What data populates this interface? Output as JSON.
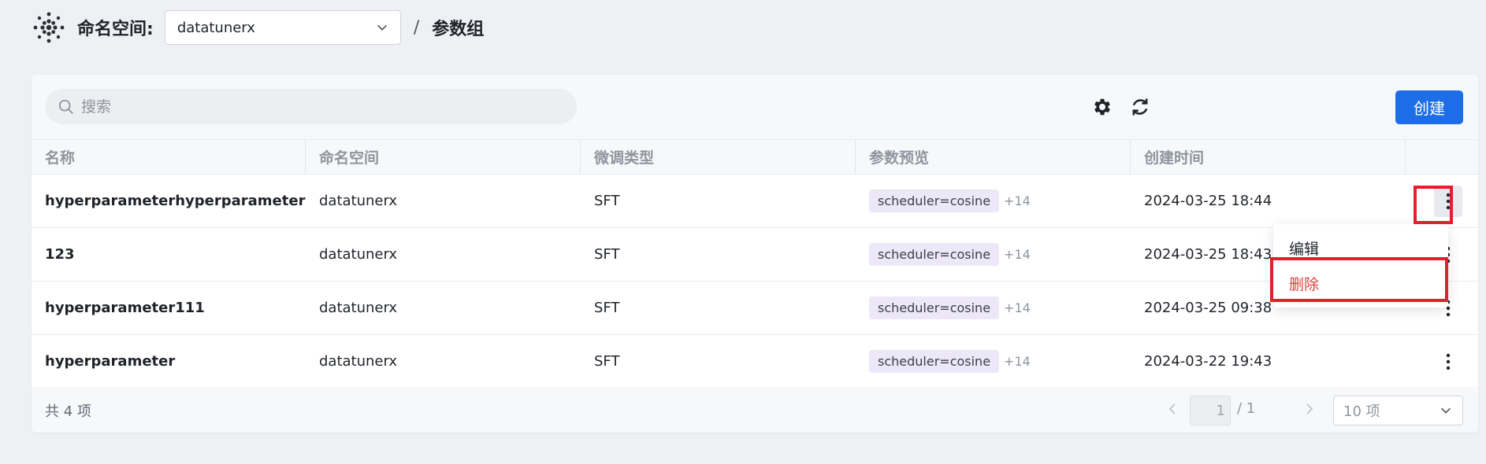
{
  "header": {
    "namespace_label": "命名空间:",
    "namespace_value": "datatunerx",
    "separator": "/",
    "page_title": "参数组"
  },
  "toolbar": {
    "search_placeholder": "搜索",
    "create_label": "创建"
  },
  "table": {
    "columns": [
      "名称",
      "命名空间",
      "微调类型",
      "参数预览",
      "创建时间",
      ""
    ],
    "rows": [
      {
        "name": "hyperparameterhyperparameterh...",
        "namespace": "datatunerx",
        "type": "SFT",
        "tag": "scheduler=cosine",
        "more": "+14",
        "created": "2024-03-25 18:44"
      },
      {
        "name": "123",
        "namespace": "datatunerx",
        "type": "SFT",
        "tag": "scheduler=cosine",
        "more": "+14",
        "created": "2024-03-25 18:43"
      },
      {
        "name": "hyperparameter111",
        "namespace": "datatunerx",
        "type": "SFT",
        "tag": "scheduler=cosine",
        "more": "+14",
        "created": "2024-03-25 09:38"
      },
      {
        "name": "hyperparameter",
        "namespace": "datatunerx",
        "type": "SFT",
        "tag": "scheduler=cosine",
        "more": "+14",
        "created": "2024-03-22 19:43"
      }
    ]
  },
  "footer": {
    "total": "共 4 项",
    "current_page": "1",
    "page_total": "/ 1",
    "page_size": "10 项"
  },
  "menu": {
    "edit": "编辑",
    "delete": "删除"
  },
  "colors": {
    "primary": "#1d6ee6",
    "danger": "#e03e3e",
    "highlight": "#e0202a"
  }
}
